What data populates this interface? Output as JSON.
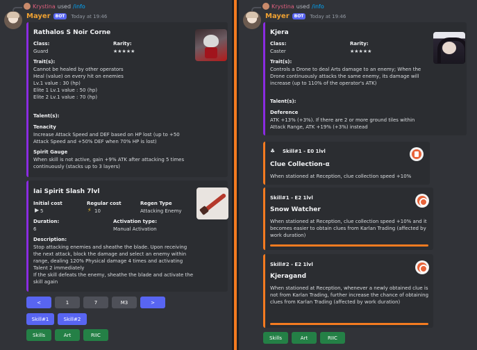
{
  "left": {
    "reply": {
      "user": "Krystina",
      "used": "used",
      "command": "/info"
    },
    "author": {
      "name": "Mayer",
      "bot": "BOT",
      "time": "Today at 19:46"
    },
    "operator": {
      "name": "Rathalos S Noir Corne",
      "class_label": "Class:",
      "class_value": "Guard",
      "rarity_label": "Rarity:",
      "rarity_value": "★★★★★",
      "traits_label": "Trait(s):",
      "traits": [
        "Cannot be healed by other operators",
        "Heal (value) on every hit on enemies",
        "Lv.1 value : 30 (hp)",
        "Elite 1 Lv.1 value : 50 (hp)",
        "Elite 2 Lv.1 value : 70 (hp)"
      ],
      "talents_label": "Talent(s):",
      "talent1_name": "Tenacity",
      "talent1_desc": "Increase Attack Speed and DEF based on HP lost (up to +50 Attack Speed and +50% DEF when 70% HP is lost)",
      "talent2_name": "Spirit Gauge",
      "talent2_desc": "When skill is not active, gain +9% ATK after attacking 5 times continuously (stacks up to 3 layers)"
    },
    "skill": {
      "name": "Iai Spirit Slash 7lvl",
      "initial_label": "Initial cost",
      "initial_value": "5",
      "regular_label": "Regular cost",
      "regular_value": "10",
      "regen_label": "Regen Type",
      "regen_value": "Attacking Enemy",
      "duration_label": "Duration:",
      "duration_value": "6",
      "activation_label": "Activation type:",
      "activation_value": "Manual Activation",
      "description_label": "Description:",
      "description": "Stop attacking enemies and sheathe the blade. Upon receiving the next attack, block the damage and select an enemy within range, dealing 120% Physical damage 4 times and activating Talent 2 immediately\nIf the skill defeats the enemy, sheathe the blade and activate the skill again"
    },
    "buttons_row1": [
      "<",
      "1",
      "7",
      "M3",
      ">"
    ],
    "buttons_row2": [
      "Skill#1",
      "Skill#2"
    ],
    "buttons_row3": [
      "Skills",
      "Art",
      "RIIC"
    ]
  },
  "right": {
    "reply": {
      "user": "Krystina",
      "used": "used",
      "command": "/info"
    },
    "author": {
      "name": "Mayer",
      "bot": "BOT",
      "time": "Today at 19:46"
    },
    "operator": {
      "name": "Kjera",
      "class_label": "Class:",
      "class_value": "Caster",
      "rarity_label": "Rarity:",
      "rarity_value": "★★★★★",
      "traits_label": "Trait(s):",
      "traits_text": "Controls a Drone to deal Arts damage to an enemy; When the Drone continuously attacks the same enemy, its damage will increase (up to 110% of the operator's ATK)",
      "talents_label": "Talent(s):",
      "talent1_name": "Deference",
      "talent1_desc": "ATK +13% (+3%). If there are 2 or more ground tiles within Attack Range, ATK +19% (+3%) instead"
    },
    "riic": [
      {
        "header": "Skill#1 - E0 1lvl",
        "name": "Clue Collection-α",
        "desc": "When stationed at Reception, clue collection speed +10%"
      },
      {
        "header": "Skill#1 - E2 1lvl",
        "name": "Snow Watcher",
        "desc": "When stationed at Reception, clue collection speed +10% and it becomes easier to obtain clues from Karlan Trading (affected by work duration)"
      },
      {
        "header": "Skill#2 - E2 1lvl",
        "name": "Kjeragand",
        "desc": "When stationed at Reception, whenever a newly obtained clue is not from Karlan Trading, further increase the chance of obtaining clues from Karlan Trading (affected by work duration)"
      }
    ],
    "buttons": [
      "Skills",
      "Art",
      "RIIC"
    ]
  }
}
